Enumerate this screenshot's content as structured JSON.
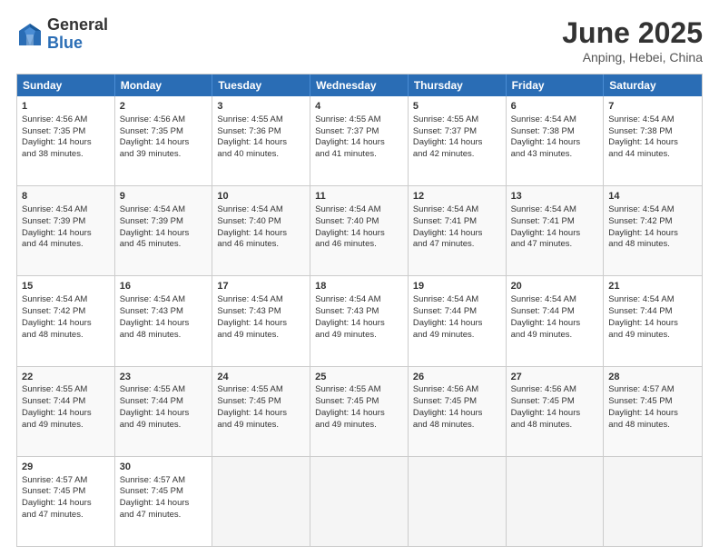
{
  "logo": {
    "general": "General",
    "blue": "Blue"
  },
  "title": "June 2025",
  "subtitle": "Anping, Hebei, China",
  "weekdays": [
    "Sunday",
    "Monday",
    "Tuesday",
    "Wednesday",
    "Thursday",
    "Friday",
    "Saturday"
  ],
  "weeks": [
    [
      {
        "day": "1",
        "lines": [
          "Sunrise: 4:56 AM",
          "Sunset: 7:35 PM",
          "Daylight: 14 hours",
          "and 38 minutes."
        ]
      },
      {
        "day": "2",
        "lines": [
          "Sunrise: 4:56 AM",
          "Sunset: 7:35 PM",
          "Daylight: 14 hours",
          "and 39 minutes."
        ]
      },
      {
        "day": "3",
        "lines": [
          "Sunrise: 4:55 AM",
          "Sunset: 7:36 PM",
          "Daylight: 14 hours",
          "and 40 minutes."
        ]
      },
      {
        "day": "4",
        "lines": [
          "Sunrise: 4:55 AM",
          "Sunset: 7:37 PM",
          "Daylight: 14 hours",
          "and 41 minutes."
        ]
      },
      {
        "day": "5",
        "lines": [
          "Sunrise: 4:55 AM",
          "Sunset: 7:37 PM",
          "Daylight: 14 hours",
          "and 42 minutes."
        ]
      },
      {
        "day": "6",
        "lines": [
          "Sunrise: 4:54 AM",
          "Sunset: 7:38 PM",
          "Daylight: 14 hours",
          "and 43 minutes."
        ]
      },
      {
        "day": "7",
        "lines": [
          "Sunrise: 4:54 AM",
          "Sunset: 7:38 PM",
          "Daylight: 14 hours",
          "and 44 minutes."
        ]
      }
    ],
    [
      {
        "day": "8",
        "lines": [
          "Sunrise: 4:54 AM",
          "Sunset: 7:39 PM",
          "Daylight: 14 hours",
          "and 44 minutes."
        ]
      },
      {
        "day": "9",
        "lines": [
          "Sunrise: 4:54 AM",
          "Sunset: 7:39 PM",
          "Daylight: 14 hours",
          "and 45 minutes."
        ]
      },
      {
        "day": "10",
        "lines": [
          "Sunrise: 4:54 AM",
          "Sunset: 7:40 PM",
          "Daylight: 14 hours",
          "and 46 minutes."
        ]
      },
      {
        "day": "11",
        "lines": [
          "Sunrise: 4:54 AM",
          "Sunset: 7:40 PM",
          "Daylight: 14 hours",
          "and 46 minutes."
        ]
      },
      {
        "day": "12",
        "lines": [
          "Sunrise: 4:54 AM",
          "Sunset: 7:41 PM",
          "Daylight: 14 hours",
          "and 47 minutes."
        ]
      },
      {
        "day": "13",
        "lines": [
          "Sunrise: 4:54 AM",
          "Sunset: 7:41 PM",
          "Daylight: 14 hours",
          "and 47 minutes."
        ]
      },
      {
        "day": "14",
        "lines": [
          "Sunrise: 4:54 AM",
          "Sunset: 7:42 PM",
          "Daylight: 14 hours",
          "and 48 minutes."
        ]
      }
    ],
    [
      {
        "day": "15",
        "lines": [
          "Sunrise: 4:54 AM",
          "Sunset: 7:42 PM",
          "Daylight: 14 hours",
          "and 48 minutes."
        ]
      },
      {
        "day": "16",
        "lines": [
          "Sunrise: 4:54 AM",
          "Sunset: 7:43 PM",
          "Daylight: 14 hours",
          "and 48 minutes."
        ]
      },
      {
        "day": "17",
        "lines": [
          "Sunrise: 4:54 AM",
          "Sunset: 7:43 PM",
          "Daylight: 14 hours",
          "and 49 minutes."
        ]
      },
      {
        "day": "18",
        "lines": [
          "Sunrise: 4:54 AM",
          "Sunset: 7:43 PM",
          "Daylight: 14 hours",
          "and 49 minutes."
        ]
      },
      {
        "day": "19",
        "lines": [
          "Sunrise: 4:54 AM",
          "Sunset: 7:44 PM",
          "Daylight: 14 hours",
          "and 49 minutes."
        ]
      },
      {
        "day": "20",
        "lines": [
          "Sunrise: 4:54 AM",
          "Sunset: 7:44 PM",
          "Daylight: 14 hours",
          "and 49 minutes."
        ]
      },
      {
        "day": "21",
        "lines": [
          "Sunrise: 4:54 AM",
          "Sunset: 7:44 PM",
          "Daylight: 14 hours",
          "and 49 minutes."
        ]
      }
    ],
    [
      {
        "day": "22",
        "lines": [
          "Sunrise: 4:55 AM",
          "Sunset: 7:44 PM",
          "Daylight: 14 hours",
          "and 49 minutes."
        ]
      },
      {
        "day": "23",
        "lines": [
          "Sunrise: 4:55 AM",
          "Sunset: 7:44 PM",
          "Daylight: 14 hours",
          "and 49 minutes."
        ]
      },
      {
        "day": "24",
        "lines": [
          "Sunrise: 4:55 AM",
          "Sunset: 7:45 PM",
          "Daylight: 14 hours",
          "and 49 minutes."
        ]
      },
      {
        "day": "25",
        "lines": [
          "Sunrise: 4:55 AM",
          "Sunset: 7:45 PM",
          "Daylight: 14 hours",
          "and 49 minutes."
        ]
      },
      {
        "day": "26",
        "lines": [
          "Sunrise: 4:56 AM",
          "Sunset: 7:45 PM",
          "Daylight: 14 hours",
          "and 48 minutes."
        ]
      },
      {
        "day": "27",
        "lines": [
          "Sunrise: 4:56 AM",
          "Sunset: 7:45 PM",
          "Daylight: 14 hours",
          "and 48 minutes."
        ]
      },
      {
        "day": "28",
        "lines": [
          "Sunrise: 4:57 AM",
          "Sunset: 7:45 PM",
          "Daylight: 14 hours",
          "and 48 minutes."
        ]
      }
    ],
    [
      {
        "day": "29",
        "lines": [
          "Sunrise: 4:57 AM",
          "Sunset: 7:45 PM",
          "Daylight: 14 hours",
          "and 47 minutes."
        ]
      },
      {
        "day": "30",
        "lines": [
          "Sunrise: 4:57 AM",
          "Sunset: 7:45 PM",
          "Daylight: 14 hours",
          "and 47 minutes."
        ]
      },
      {
        "day": "",
        "lines": []
      },
      {
        "day": "",
        "lines": []
      },
      {
        "day": "",
        "lines": []
      },
      {
        "day": "",
        "lines": []
      },
      {
        "day": "",
        "lines": []
      }
    ]
  ]
}
